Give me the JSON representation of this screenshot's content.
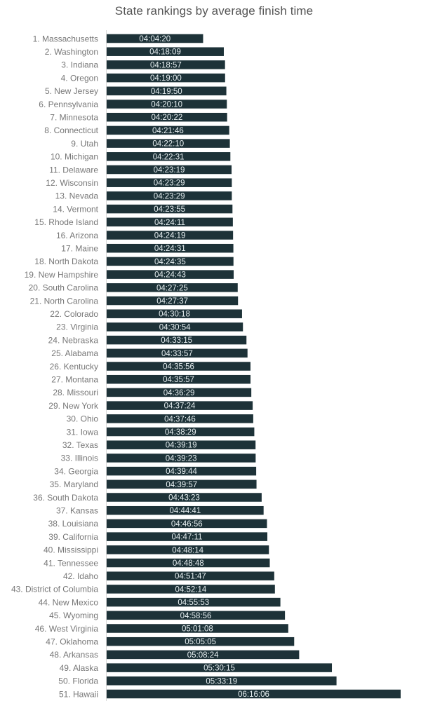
{
  "chart_data": {
    "type": "bar",
    "orientation": "horizontal",
    "title": "State rankings by average finish time",
    "xlabel": "",
    "ylabel": "",
    "xlim": [
      "03:00:00",
      "06:16:06"
    ],
    "grid": false,
    "legend": "none",
    "bar_color": "#1d3238",
    "categories": [
      "1. Massachusetts",
      "2. Washington",
      "3. Indiana",
      "4. Oregon",
      "5. New Jersey",
      "6. Pennsylvania",
      "7. Minnesota",
      "8. Connecticut",
      "9. Utah",
      "10. Michigan",
      "11. Delaware",
      "12. Wisconsin",
      "13. Nevada",
      "14. Vermont",
      "15. Rhode Island",
      "16. Arizona",
      "17. Maine",
      "18. North Dakota",
      "19. New Hampshire",
      "20. South Carolina",
      "21. North Carolina",
      "22. Colorado",
      "23. Virginia",
      "24. Nebraska",
      "25. Alabama",
      "26. Kentucky",
      "27. Montana",
      "28. Missouri",
      "29. New York",
      "30. Ohio",
      "31. Iowa",
      "32. Texas",
      "33. Illinois",
      "34. Georgia",
      "35. Maryland",
      "36. South Dakota",
      "37. Kansas",
      "38. Louisiana",
      "39. California",
      "40. Mississippi",
      "41. Tennessee",
      "42. Idaho",
      "43. District of Columbia",
      "44. New Mexico",
      "45. Wyoming",
      "46. West Virginia",
      "47. Oklahoma",
      "48. Arkansas",
      "49. Alaska",
      "50. Florida",
      "51. Hawaii"
    ],
    "values": [
      "04:04:20",
      "04:18:09",
      "04:18:57",
      "04:19:00",
      "04:19:50",
      "04:20:10",
      "04:20:22",
      "04:21:46",
      "04:22:10",
      "04:22:31",
      "04:23:19",
      "04:23:29",
      "04:23:29",
      "04:23:55",
      "04:24:11",
      "04:24:19",
      "04:24:31",
      "04:24:35",
      "04:24:43",
      "04:27:25",
      "04:27:37",
      "04:30:18",
      "04:30:54",
      "04:33:15",
      "04:33:57",
      "04:35:56",
      "04:35:57",
      "04:36:29",
      "04:37:24",
      "04:37:46",
      "04:38:29",
      "04:39:19",
      "04:39:23",
      "04:39:44",
      "04:39:57",
      "04:43:23",
      "04:44:41",
      "04:46:56",
      "04:47:11",
      "04:48:14",
      "04:48:48",
      "04:51:47",
      "04:52:14",
      "04:55:53",
      "04:58:56",
      "05:01:08",
      "05:05:05",
      "05:08:24",
      "05:30:15",
      "05:33:19",
      "06:16:06"
    ]
  }
}
